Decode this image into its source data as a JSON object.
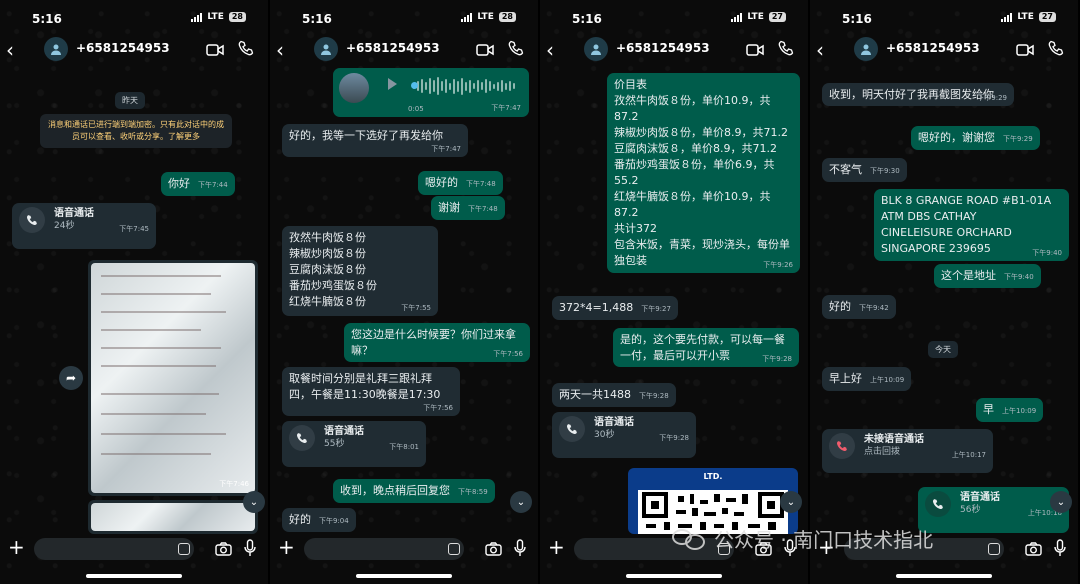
{
  "status": {
    "time": "5:16",
    "network": "LTE",
    "battery": [
      "28",
      "28",
      "27",
      "27"
    ]
  },
  "contact": {
    "number": "+6581254953"
  },
  "panel1": {
    "date_yesterday": "昨天",
    "encryption": "消息和通话已进行端到端加密。只有此对话中的成员可以查看、收听或分享。了解更多",
    "msg_hello": {
      "text": "你好",
      "time": "下午7:44"
    },
    "call": {
      "title": "语音通话",
      "sub": "24秒",
      "time": "下午7:45"
    },
    "photo": {
      "time": "下午7:46"
    }
  },
  "panel2": {
    "voice": {
      "duration": "0:05",
      "time": "下午7:47"
    },
    "m1": {
      "text": "好的，我等一下选好了再发给你",
      "time": "下午7:47"
    },
    "m2": {
      "text": "嗯好的",
      "time": "下午7:48"
    },
    "m3": {
      "text": "谢谢",
      "time": "下午7:48"
    },
    "m4": {
      "lines": [
        "孜然牛肉饭８份",
        "辣椒炒肉饭８份",
        "豆腐肉沫饭８份",
        "番茄炒鸡蛋饭８份",
        "红烧牛腩饭８份"
      ],
      "time": "下午7:55"
    },
    "m5": {
      "text": "您这边是什么时候要？你们过来拿嘛？",
      "time": "下午7:56"
    },
    "m6": {
      "text": "取餐时间分别是礼拜三跟礼拜四，午餐是11:30晚餐是17:30",
      "time": "下午7:56"
    },
    "call": {
      "title": "语音通话",
      "sub": "55秒",
      "time": "下午8:01"
    },
    "m7": {
      "text": "收到，晚点稍后回复您",
      "time": "下午8:59"
    },
    "m8": {
      "text": "好的",
      "time": "下午9:04"
    }
  },
  "panel3": {
    "menu": {
      "lines": [
        "价目表",
        "孜然牛肉饭８份，单价10.9，共87.2",
        "辣椒炒肉饭８份，单价8.9，共71.2",
        "豆腐肉沫饭８，单价8.9，共71.2",
        "番茄炒鸡蛋饭８份，单价6.9，共55.2",
        "红烧牛腩饭８份，单价10.9，共87.2",
        "共计372",
        "包含米饭，青菜，现炒浇头，每份单独包装"
      ],
      "time": "下午9:26"
    },
    "calc": {
      "text": "372*4=1,488",
      "time": "下午9:27"
    },
    "m1": {
      "text": "是的，这个要先付款，可以每一餐一付，最后可以开小票",
      "time": "下午9:28"
    },
    "m2": {
      "text": "两天一共1488",
      "time": "下午9:28"
    },
    "call": {
      "title": "语音通话",
      "sub": "30秒",
      "time": "下午9:28"
    },
    "qr_label": "LTD."
  },
  "panel4": {
    "m1": {
      "text": "收到，明天付好了我再截图发给你",
      "time": "下午9:29"
    },
    "m2": {
      "text": "嗯好的，谢谢您",
      "time": "下午9:29"
    },
    "m3": {
      "text": "不客气",
      "time": "下午9:30"
    },
    "address": {
      "lines": [
        "BLK 8 GRANGE ROAD #B1-01A",
        "ATM DBS CATHAY",
        "CINELEISURE ORCHARD",
        "SINGAPORE 239695"
      ],
      "time": "下午9:40"
    },
    "m4": {
      "text": "这个是地址",
      "time": "下午9:40"
    },
    "m5": {
      "text": "好的",
      "time": "下午9:42"
    },
    "date_today": "今天",
    "m6": {
      "text": "早上好",
      "time": "上午10:09"
    },
    "m7": {
      "text": "早",
      "time": "上午10:09"
    },
    "missed": {
      "title": "未接语音通话",
      "sub": "点击回拨",
      "time": "上午10:17"
    },
    "call": {
      "title": "语音通话",
      "sub": "56秒",
      "time": "上午10:18"
    }
  },
  "watermark": "公众号 · 南门口技术指北"
}
